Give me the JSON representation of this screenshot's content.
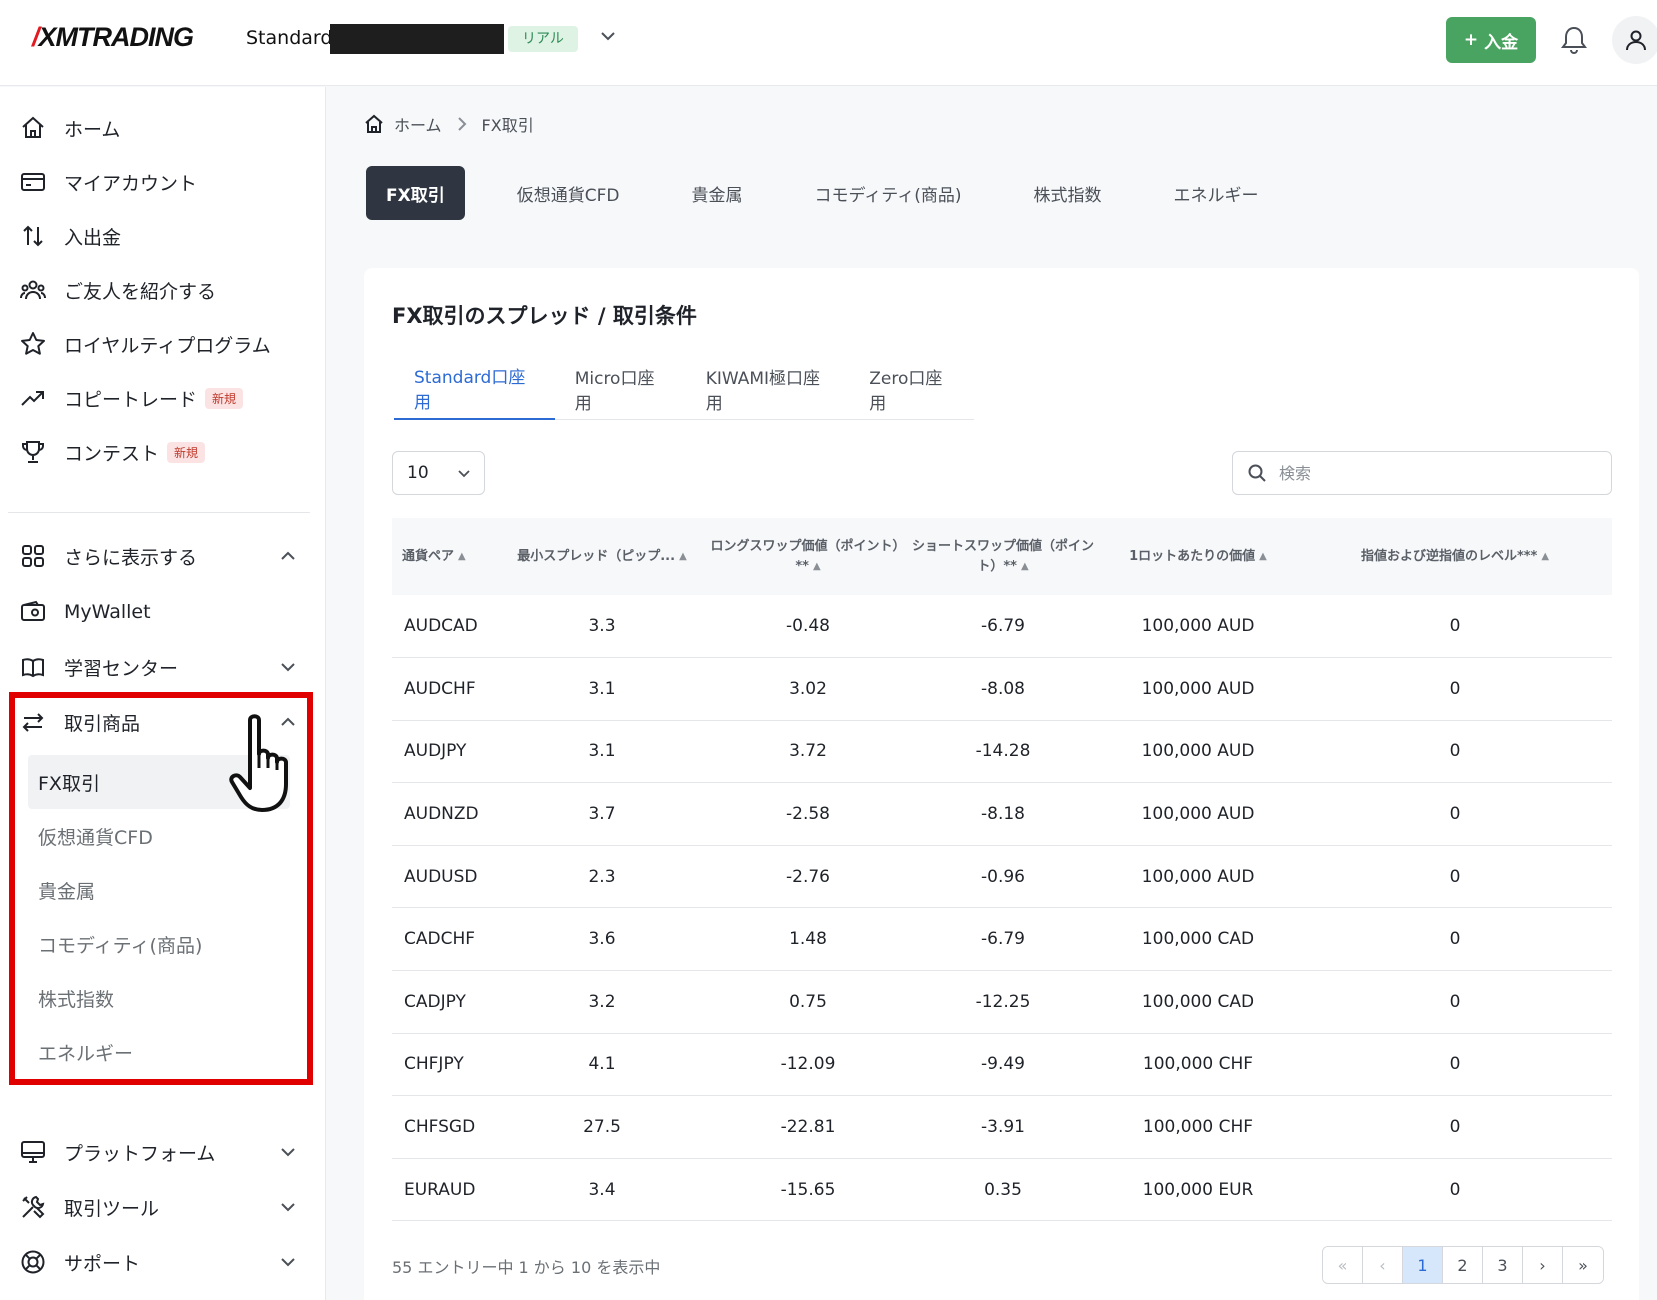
{
  "header": {
    "logo": "XMTRADING",
    "account_name": "Standard",
    "account_badge": "リアル",
    "deposit_label": "入金",
    "colors": {
      "deposit": "#4aa461",
      "badge_bg": "#dff3e4"
    }
  },
  "sidebar": {
    "items": [
      {
        "label": "ホーム",
        "icon": "home-icon"
      },
      {
        "label": "マイアカウント",
        "icon": "credit-card-icon"
      },
      {
        "label": "入出金",
        "icon": "transfer-arrows-icon"
      },
      {
        "label": "ご友人を紹介する",
        "icon": "users-icon"
      },
      {
        "label": "ロイヤルティプログラム",
        "icon": "star-icon"
      },
      {
        "label": "コピートレード",
        "icon": "trend-up-icon",
        "tag": "新規"
      },
      {
        "label": "コンテスト",
        "icon": "trophy-icon",
        "tag": "新規"
      }
    ],
    "more": {
      "label": "さらに表示する",
      "icon": "grid-icon"
    },
    "mywallet": {
      "label": "MyWallet",
      "icon": "wallet-icon"
    },
    "learning": {
      "label": "学習センター",
      "icon": "book-icon"
    },
    "instruments": {
      "label": "取引商品",
      "icon": "swap-icon",
      "sub": [
        "FX取引",
        "仮想通貨CFD",
        "貴金属",
        "コモディティ(商品)",
        "株式指数",
        "エネルギー"
      ]
    },
    "platform": {
      "label": "プラットフォーム",
      "icon": "monitor-icon"
    },
    "tools": {
      "label": "取引ツール",
      "icon": "tools-icon"
    },
    "support": {
      "label": "サポート",
      "icon": "lifebuoy-icon"
    }
  },
  "breadcrumb": {
    "home": "ホーム",
    "current": "FX取引"
  },
  "top_tabs": [
    "FX取引",
    "仮想通貨CFD",
    "貴金属",
    "コモディティ(商品)",
    "株式指数",
    "エネルギー"
  ],
  "card": {
    "title": "FX取引のスプレッド / 取引条件",
    "account_tabs": [
      "Standard口座用",
      "Micro口座用",
      "KIWAMI極口座用",
      "Zero口座用"
    ],
    "page_length": "10",
    "search_placeholder": "検索",
    "columns": [
      "通貨ペア",
      "最小スプレッド（ピップ...",
      "ロングスワップ価値（ポイント）**",
      "ショートスワップ価値（ポイント）**",
      "1ロットあたりの価値",
      "指値および逆指値のレベル***"
    ],
    "rows": [
      [
        "AUDCAD",
        "3.3",
        "-0.48",
        "-6.79",
        "100,000 AUD",
        "0"
      ],
      [
        "AUDCHF",
        "3.1",
        "3.02",
        "-8.08",
        "100,000 AUD",
        "0"
      ],
      [
        "AUDJPY",
        "3.1",
        "3.72",
        "-14.28",
        "100,000 AUD",
        "0"
      ],
      [
        "AUDNZD",
        "3.7",
        "-2.58",
        "-8.18",
        "100,000 AUD",
        "0"
      ],
      [
        "AUDUSD",
        "2.3",
        "-2.76",
        "-0.96",
        "100,000 AUD",
        "0"
      ],
      [
        "CADCHF",
        "3.6",
        "1.48",
        "-6.79",
        "100,000 CAD",
        "0"
      ],
      [
        "CADJPY",
        "3.2",
        "0.75",
        "-12.25",
        "100,000 CAD",
        "0"
      ],
      [
        "CHFJPY",
        "4.1",
        "-12.09",
        "-9.49",
        "100,000 CHF",
        "0"
      ],
      [
        "CHFSGD",
        "27.5",
        "-22.81",
        "-3.91",
        "100,000 CHF",
        "0"
      ],
      [
        "EURAUD",
        "3.4",
        "-15.65",
        "0.35",
        "100,000 EUR",
        "0"
      ]
    ],
    "info": "55 エントリー中 1 から 10 を表示中",
    "pages": [
      "1",
      "2",
      "3"
    ]
  }
}
